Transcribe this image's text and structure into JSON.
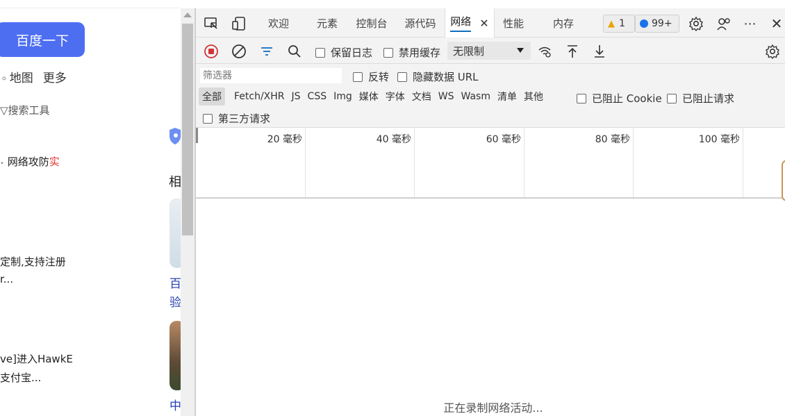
{
  "page": {
    "search_button": "百度一下",
    "links": [
      "地图",
      "更多"
    ],
    "search_tools": "搜索工具",
    "results": [
      {
        "text": "网络攻防",
        "highlight": "实"
      },
      {
        "text": "定制,支持注册"
      },
      {
        "text": "r..."
      },
      {
        "text": "ve]进入HawkE"
      },
      {
        "text": "支付宝..."
      }
    ],
    "right_col": {
      "heading": "相",
      "link1_line1": "百",
      "link1_line2": "验",
      "link2": "中"
    }
  },
  "devtools": {
    "tabs": [
      "欢迎",
      "元素",
      "控制台",
      "源代码",
      "网络",
      "性能",
      "内存"
    ],
    "active_tab": "网络",
    "warnings_count": "1",
    "messages_count": "99+",
    "toolbar": {
      "preserve_log": "保留日志",
      "disable_cache": "禁用缓存",
      "throttling": "无限制"
    },
    "filter": {
      "placeholder": "筛选器",
      "invert": "反转",
      "hide_data_urls": "隐藏数据 URL",
      "types": [
        "全部",
        "Fetch/XHR",
        "JS",
        "CSS",
        "Img",
        "媒体",
        "字体",
        "文档",
        "WS",
        "Wasm",
        "清单",
        "其他"
      ],
      "blocked_cookies": "已阻止 Cookie",
      "blocked_requests": "已阻止请求",
      "third_party": "第三方请求"
    },
    "timeline_ticks": [
      "20 毫秒",
      "40 毫秒",
      "60 毫秒",
      "80 毫秒",
      "100 毫秒"
    ],
    "empty_message": "正在录制网络活动..."
  }
}
